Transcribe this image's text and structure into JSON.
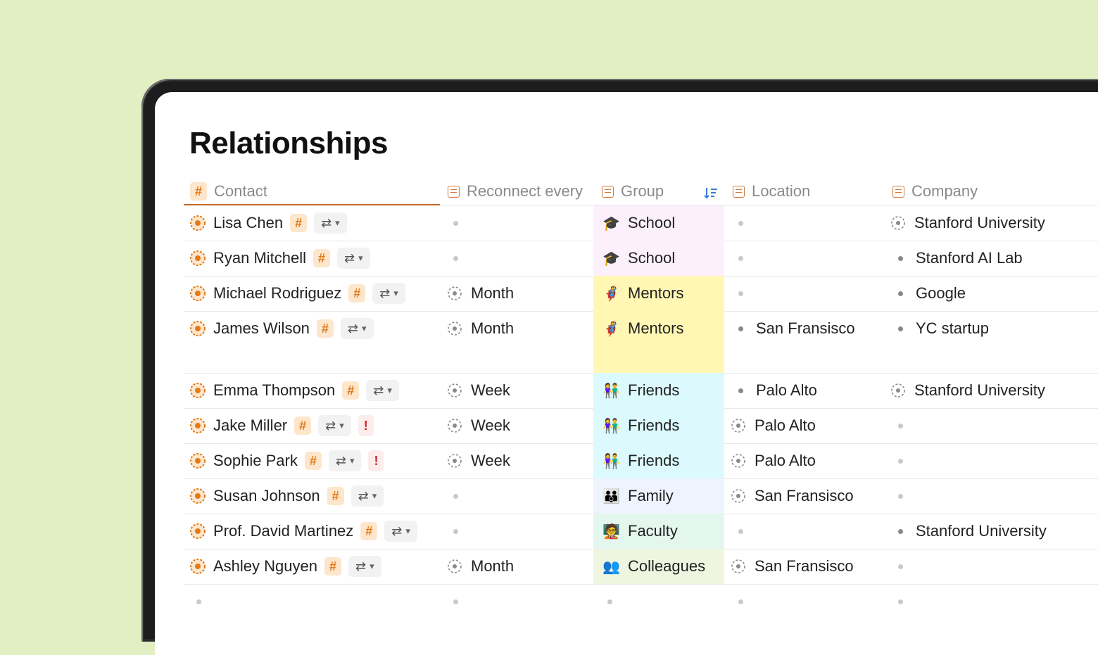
{
  "page": {
    "title": "Relationships"
  },
  "columns": {
    "contact": "Contact",
    "reconnect": "Reconnect every",
    "group": "Group",
    "location": "Location",
    "company": "Company"
  },
  "colors": {
    "School": "#fdf0fd",
    "Mentors": "#fff7b3",
    "Friends": "#dcfafd",
    "Family": "#eff3fd",
    "Faculty": "#e4f7ee",
    "Colleagues": "#eef6e0"
  },
  "rows": [
    {
      "name": "Lisa Chen",
      "alert": false,
      "reconnect": "",
      "group": "School",
      "group_icon": "🎓",
      "location": "",
      "location_style": "empty",
      "company": "Stanford University",
      "company_style": "dashed"
    },
    {
      "name": "Ryan Mitchell",
      "alert": false,
      "reconnect": "",
      "group": "School",
      "group_icon": "🎓",
      "location": "",
      "location_style": "empty",
      "company": "Stanford AI Lab",
      "company_style": "dot"
    },
    {
      "name": "Michael Rodriguez",
      "alert": false,
      "reconnect": "Month",
      "group": "Mentors",
      "group_icon": "🦸",
      "location": "",
      "location_style": "empty",
      "company": "Google",
      "company_style": "dot"
    },
    {
      "name": "James Wilson",
      "alert": false,
      "reconnect": "Month",
      "group": "Mentors",
      "group_icon": "🦸",
      "location": "San Fransisco",
      "location_style": "dot",
      "company": "YC startup",
      "company_style": "dot"
    },
    {
      "name": "Emma Thompson",
      "alert": false,
      "reconnect": "Week",
      "group": "Friends",
      "group_icon": "👫",
      "location": "Palo Alto",
      "location_style": "dot",
      "company": "Stanford University",
      "company_style": "dashed"
    },
    {
      "name": "Jake Miller",
      "alert": true,
      "reconnect": "Week",
      "group": "Friends",
      "group_icon": "👫",
      "location": "Palo Alto",
      "location_style": "dashed",
      "company": "",
      "company_style": "empty"
    },
    {
      "name": "Sophie Park",
      "alert": true,
      "reconnect": "Week",
      "group": "Friends",
      "group_icon": "👫",
      "location": "Palo Alto",
      "location_style": "dashed",
      "company": "",
      "company_style": "empty"
    },
    {
      "name": "Susan Johnson",
      "alert": false,
      "reconnect": "",
      "group": "Family",
      "group_icon": "👪",
      "location": "San Fransisco",
      "location_style": "dashed",
      "company": "",
      "company_style": "empty"
    },
    {
      "name": "Prof. David Martinez",
      "alert": false,
      "reconnect": "",
      "group": "Faculty",
      "group_icon": "🧑‍🏫",
      "location": "",
      "location_style": "empty",
      "company": "Stanford University",
      "company_style": "dot"
    },
    {
      "name": "Ashley Nguyen",
      "alert": false,
      "reconnect": "Month",
      "group": "Colleagues",
      "group_icon": "👥",
      "location": "San Fransisco",
      "location_style": "dashed",
      "company": "",
      "company_style": "empty"
    }
  ],
  "badges": {
    "hash": "#",
    "alert": "!",
    "relation_arrows": "⇄",
    "chevron": "⌄"
  }
}
